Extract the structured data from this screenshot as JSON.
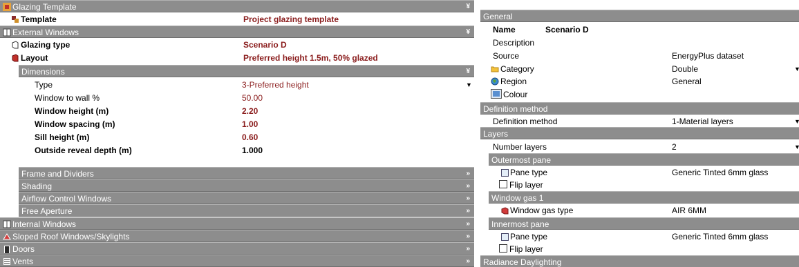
{
  "left": {
    "glazing_template_header": "Glazing Template",
    "template_label": "Template",
    "template_value": "Project glazing template",
    "external_windows_header": "External Windows",
    "glazing_type_label": "Glazing type",
    "glazing_type_value": "Scenario D",
    "layout_label": "Layout",
    "layout_value": "Preferred height 1.5m, 50% glazed",
    "dimensions_header": "Dimensions",
    "dims": {
      "type_label": "Type",
      "type_value": "3-Preferred height",
      "wwr_label": "Window to wall %",
      "wwr_value": "50.00",
      "height_label": "Window height (m)",
      "height_value": "2.20",
      "spacing_label": "Window spacing (m)",
      "spacing_value": "1.00",
      "sill_label": "Sill height (m)",
      "sill_value": "0.60",
      "reveal_label": "Outside reveal depth (m)",
      "reveal_value": "1.000"
    },
    "collapsed_sub": [
      "Frame and Dividers",
      "Shading",
      "Airflow Control Windows",
      "Free Aperture"
    ],
    "collapsed_top": [
      "Internal Windows",
      "Sloped Roof Windows/Skylights",
      "Doors",
      "Vents"
    ],
    "expanded_glyph": "¥",
    "collapsed_glyph": "»"
  },
  "right": {
    "general_header": "General",
    "name_label": "Name",
    "name_value": "Scenario D",
    "description_label": "Description",
    "description_value": "",
    "source_label": "Source",
    "source_value": "EnergyPlus dataset",
    "category_label": "Category",
    "category_value": "Double",
    "region_label": "Region",
    "region_value": "General",
    "colour_label": "Colour",
    "definition_header": "Definition method",
    "definition_label": "Definition method",
    "definition_value": "1-Material layers",
    "layers_header": "Layers",
    "number_layers_label": "Number layers",
    "number_layers_value": "2",
    "outermost_header": "Outermost pane",
    "outer_pane_label": "Pane type",
    "outer_pane_value": "Generic Tinted 6mm glass",
    "outer_flip_label": "Flip layer",
    "gas_header": "Window gas 1",
    "gas_label": "Window gas type",
    "gas_value": "AIR 6MM",
    "innermost_header": "Innermost pane",
    "inner_pane_label": "Pane type",
    "inner_pane_value": "Generic Tinted 6mm glass",
    "inner_flip_label": "Flip layer",
    "radiance_header": "Radiance Daylighting"
  }
}
